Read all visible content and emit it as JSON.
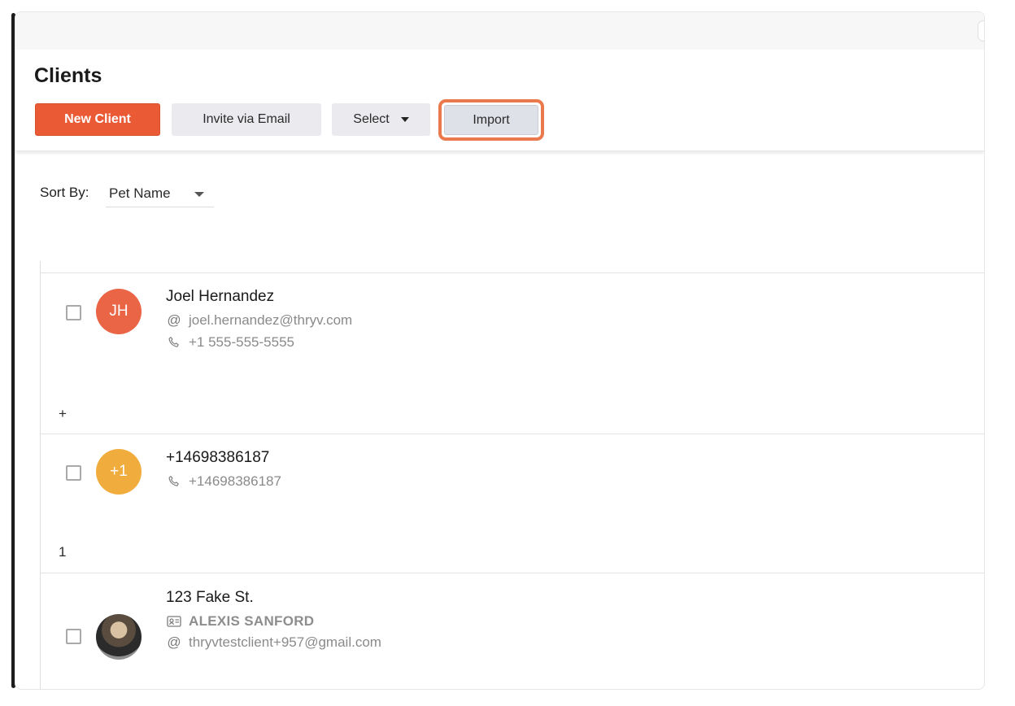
{
  "page": {
    "title": "Clients"
  },
  "toolbar": {
    "new_client": "New Client",
    "invite": "Invite via Email",
    "select": "Select",
    "import": "Import"
  },
  "sort": {
    "label": "Sort By:",
    "value": "Pet Name"
  },
  "groups": [
    {
      "label": "+"
    },
    {
      "label": "1"
    }
  ],
  "clients": [
    {
      "initials": "JH",
      "name": "Joel Hernandez",
      "email": "joel.hernandez@thryv.com",
      "phone": "+1 555-555-5555"
    },
    {
      "initials": "+1",
      "name": "+14698386187",
      "phone": "+14698386187"
    },
    {
      "name": "123 Fake St.",
      "contact_name": "ALEXIS SANFORD",
      "email": "thryvtestclient+957@gmail.com"
    }
  ],
  "colors": {
    "accent": "#ea5b35",
    "avatar_jh": "#ea6545",
    "avatar_plus1": "#f0ad3e",
    "highlight_ring": "#ea7a4e"
  },
  "icons": {
    "email": "at-icon",
    "phone": "phone-icon",
    "contact": "id-card-icon"
  }
}
